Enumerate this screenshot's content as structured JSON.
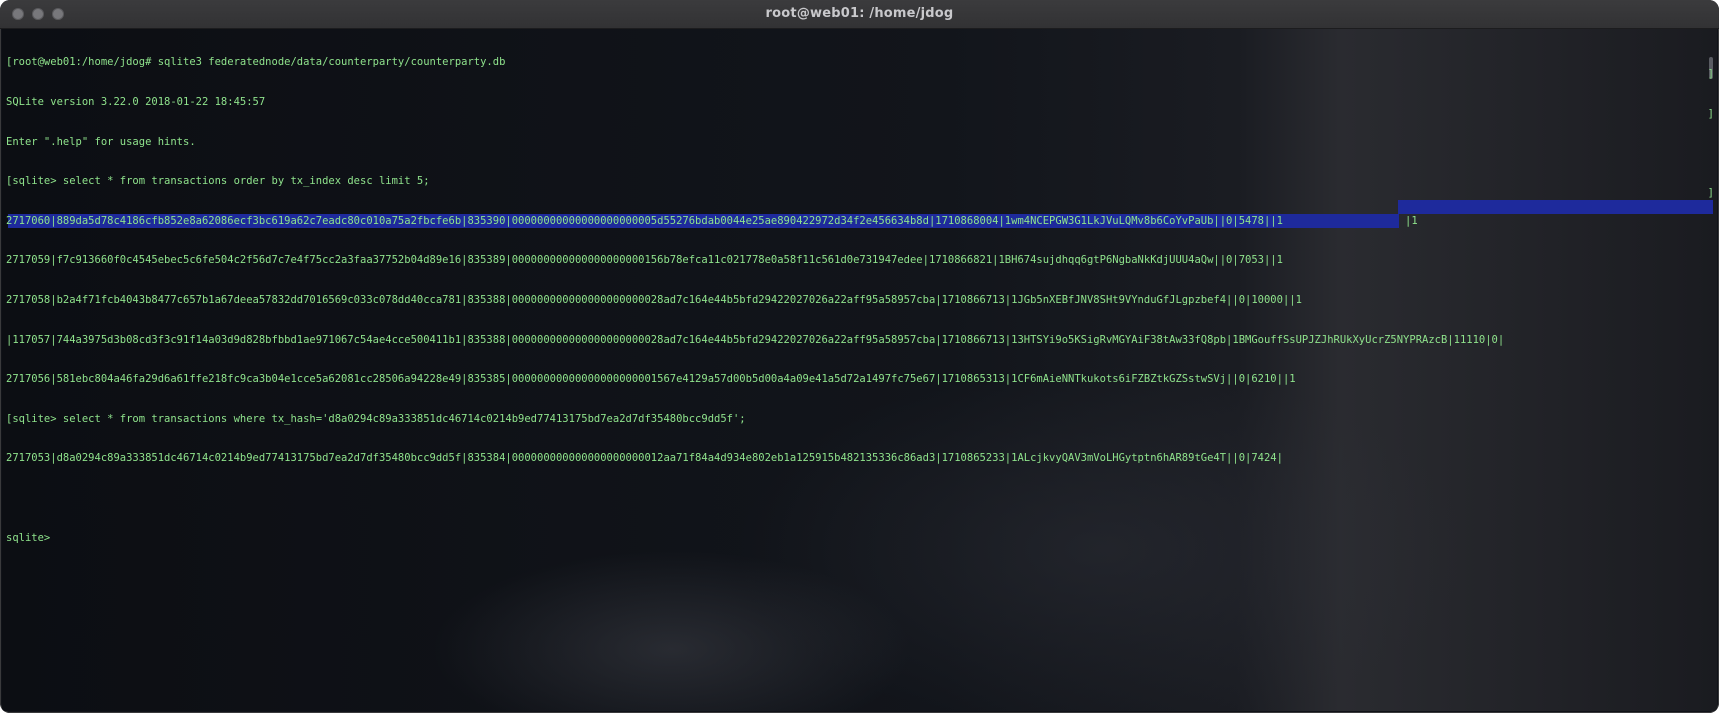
{
  "window": {
    "title": "root@web01: /home/jdog"
  },
  "terminal": {
    "lines": [
      "[root@web01:/home/jdog# sqlite3 federatednode/data/counterparty/counterparty.db",
      "SQLite version 3.22.0 2018-01-22 18:45:57",
      "Enter \".help\" for usage hints.",
      "[sqlite> select * from transactions order by tx_index desc limit 5;",
      "2717060|889da5d78c4186cfb852e8a62086ecf3bc619a62c7eadc80c010a75a2fbcfe6b|835390|00000000000000000000005d55276bdab0044e25ae890422972d34f2e456634b8d|1710868004|1wm4NCEPGW3G1LkJVuLQMv8b6CoYvPaUb||0|5478||1",
      "2717059|f7c913660f0c4545ebec5c6fe504c2f56d7c7e4f75cc2a3faa37752b04d89e16|835389|000000000000000000000156b78efca11c021778e0a58f11c561d0e731947edee|1710866821|1BH674sujdhqq6gtP6NgbaNkKdjUUU4aQw||0|7053||1",
      "2717058|b2a4f71fcb4043b8477c657b1a67deea57832dd7016569c033c078dd40cca781|835388|000000000000000000000028ad7c164e44b5bfd29422027026a22aff95a58957cba|1710866713|1JGb5nXEBfJNV8SHt9VYnduGfJLgpzbef4||0|10000||1",
      "|117057|744a3975d3b08cd3f3c91f14a03d9d828bfbbd1ae971067c54ae4cce500411b1|835388|000000000000000000000028ad7c164e44b5bfd29422027026a22aff95a58957cba|1710866713|13HTSYi9o5KSigRvMGYAiF38tAw33fQ8pb|1BMGouffSsUPJZJhRUkXyUcrZ5NYPRAzcB|11110|0|",
      "2717056|581ebc804a46fa29d6a61ffe218fc9ca3b04e1cce5a62081cc28506a94228e49|835385|00000000000000000000001567e4129a57d00b5d00a4a09e41a5d72a1497fc75e67|1710865313|1CF6mAieNNTkukots6iFZBZtkGZSstwSVj||0|6210||1",
      "[sqlite> select * from transactions where tx_hash='d8a0294c89a333851dc46714c0214b9ed77413175bd7ea2d7df35480bcc9dd5f';",
      "2717053|d8a0294c89a333851dc46714c0214b9ed77413175bd7ea2d7df35480bcc9dd5f|835384|000000000000000000000012aa71f84a4d934e802eb1a125915b482135336c86ad3|1710865233|1ALcjkvyQAV3mVoLHGytptn6hAR89tGe4T||0|7424|",
      "",
      "sqlite>"
    ],
    "trailing_value": "|1",
    "right_brackets": [
      "]",
      "]",
      "]"
    ]
  }
}
